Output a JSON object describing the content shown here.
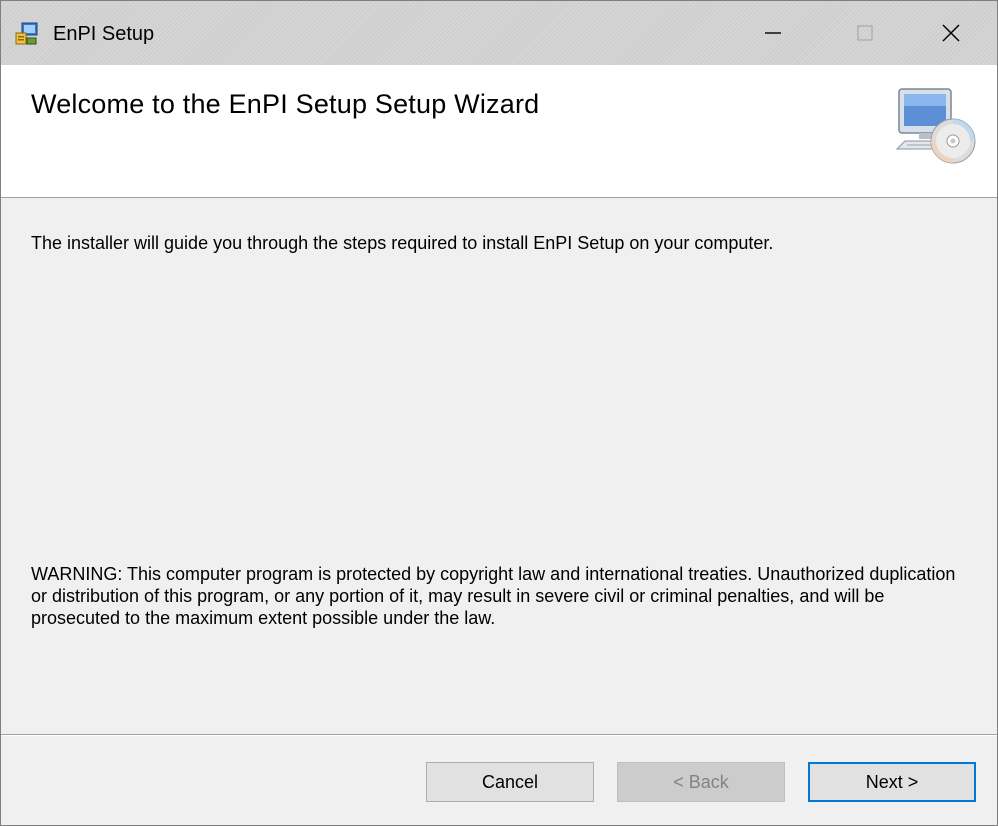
{
  "window": {
    "title": "EnPI Setup",
    "controls": {
      "minimize_glyph": "—",
      "maximize_glyph": "☐",
      "close_glyph": "✕"
    }
  },
  "header": {
    "heading": "Welcome to the EnPI Setup Setup Wizard",
    "art_icon": "computer-cd-icon"
  },
  "body": {
    "intro": "The installer will guide you through the steps required to install EnPI Setup on your computer.",
    "warning": "WARNING: This computer program is protected by copyright law and international treaties. Unauthorized duplication or distribution of this program, or any portion of it, may result in severe civil or criminal penalties, and will be prosecuted to the maximum extent possible under the law."
  },
  "buttons": {
    "cancel": "Cancel",
    "back": "< Back",
    "next": "Next >"
  },
  "colors": {
    "focus_border": "#0078d7",
    "disabled_text": "#838383"
  }
}
